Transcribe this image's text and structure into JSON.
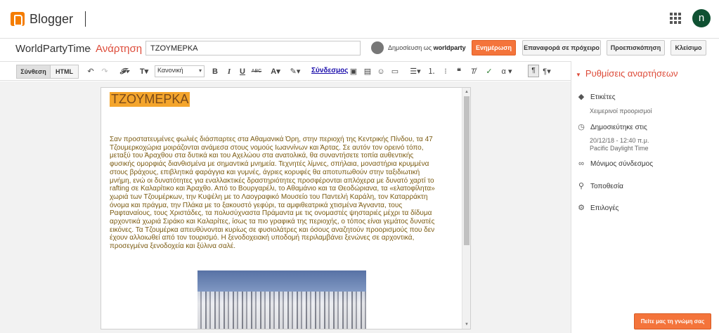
{
  "app": {
    "name": "Blogger",
    "avatar_letter": "n",
    "accent_color": "#f57d00",
    "button_color": "#f4743b"
  },
  "titlebar": {
    "blog_name": "WorldPartyTime",
    "separator": "·",
    "section": "Ανάρτηση",
    "post_title_value": "ΤΖΟΥΜΕΡΚΑ",
    "publishing_as": "Δημοσίευση ως",
    "publisher": "worldparty",
    "update_label": "Ενημέρωση",
    "revert_label": "Επαναφορά σε πρόχειρο",
    "preview_label": "Προεπισκόπηση",
    "close_label": "Κλείσιμο"
  },
  "toolbar": {
    "compose_label": "Σύνθεση",
    "html_label": "HTML",
    "format_value": "Κανονική",
    "link_label": "Σύνδεσμος",
    "icons": [
      "undo-icon",
      "redo-icon",
      "font-family-icon",
      "font-size-icon",
      "bold-icon",
      "italic-icon",
      "underline-icon",
      "strikethrough-icon",
      "text-color-icon",
      "highlight-icon",
      "image-icon",
      "video-icon",
      "emoji-icon",
      "jump-break-icon",
      "align-icon",
      "numbered-list-icon",
      "bulleted-list-icon",
      "quote-icon",
      "clear-format-icon",
      "spellcheck-icon",
      "special-chars-icon",
      "ltr-icon",
      "rtl-icon"
    ]
  },
  "editor": {
    "title": "ΤΖΟΥΜΕΡΚΑ",
    "body_lines": [
      "Σαν προστατευμένες φωλιές διάσπαρτες στα Αθαμανικά Όρη, στην περιοχή της Κεντρικής Πίνδου, τα 47",
      "Τζουμερκοχώρια μοιράζονται ανάμεσα στους νομούς Ιωαννίνων και Άρτας. Σε αυτόν τον ορεινό τόπο,",
      "μεταξύ του Άραχθου στα δυτικά και του Αχελώου στα ανατολικά, θα συναντήσετε τοπία αυθεντικής",
      "φυσικής ομορφιάς διανθισμένα με σημαντικά μνημεία. Τεχνητές λίμνες, σπήλαια, μοναστήρια κρυμμένα",
      "στους βράχους, επιβλητικά φαράγγια και γυμνές, άγριες κορυφές θα αποτυπωθούν στην ταξιδιωτική",
      "μνήμη, ενώ οι δυνατότητες για εναλλακτικές δραστηριότητες προσφέρονται απλόχερα με δυνατό χαρτί το",
      "rafting σε Καλαρίτικο και Άραχθο. Από το Βουργαρέλι, το Αθαμάνιο και τα Θεοδώριανα, τα «ελατοφίλητα»",
      "χωριά των Τζουμέρκων, την Κυψέλη με το Λαογραφικό Μουσείο του Παντελή Καράλη, τον Καταρράκτη",
      "όνομα και πράγμα, την Πλάκα με το ξακουστό γεφύρι, τα αμφιθεατρικά χτισμένα Άγναντα, τους",
      "Ραφταναίους, τους Χριστάδες, τα πολυσύχναστα Πράμαντα με τις ονομαστές ψησταριές μέχρι τα δίδυμα",
      "αρχοντικά χωριά Σιράκο και Καλαρίτες, ίσως τα πιο γραφικά της περιοχής, ο τόπος είναι γεμάτος δυνατές",
      "εικόνες. Τα Τζουμέρκα απευθύνονται κυρίως σε φυσιολάτρες και όσους αναζητούν προορισμούς που δεν",
      "έχουν αλλοιωθεί από τον τουρισμό. Η ξενοδοχειακή υποδομή περιλαμβάνει ξενώνες σε αρχοντικά,",
      "προσεγμένα ξενοδοχεία και ξύλινα σαλέ."
    ],
    "title_highlight_color": "#f4a52c",
    "body_text_color": "#7a5a10"
  },
  "sidebar": {
    "header": "Ρυθμίσεις αναρτήσεων",
    "items": [
      {
        "label": "Ετικέτες",
        "icon": "label-icon",
        "sub": [
          "Χειμερινοί προορισμοί"
        ]
      },
      {
        "label": "Δημοσιεύτηκε στις",
        "icon": "clock-icon",
        "sub": [
          "20/12/18 - 12:40 π.μ.",
          "Pacific Daylight Time"
        ]
      },
      {
        "label": "Μόνιμος σύνδεσμος",
        "icon": "link-icon",
        "sub": []
      },
      {
        "label": "Τοποθεσία",
        "icon": "location-pin-icon",
        "sub": []
      },
      {
        "label": "Επιλογές",
        "icon": "gear-icon",
        "sub": []
      }
    ]
  },
  "feedback_label": "Πείτε μας τη γνώμη σας"
}
